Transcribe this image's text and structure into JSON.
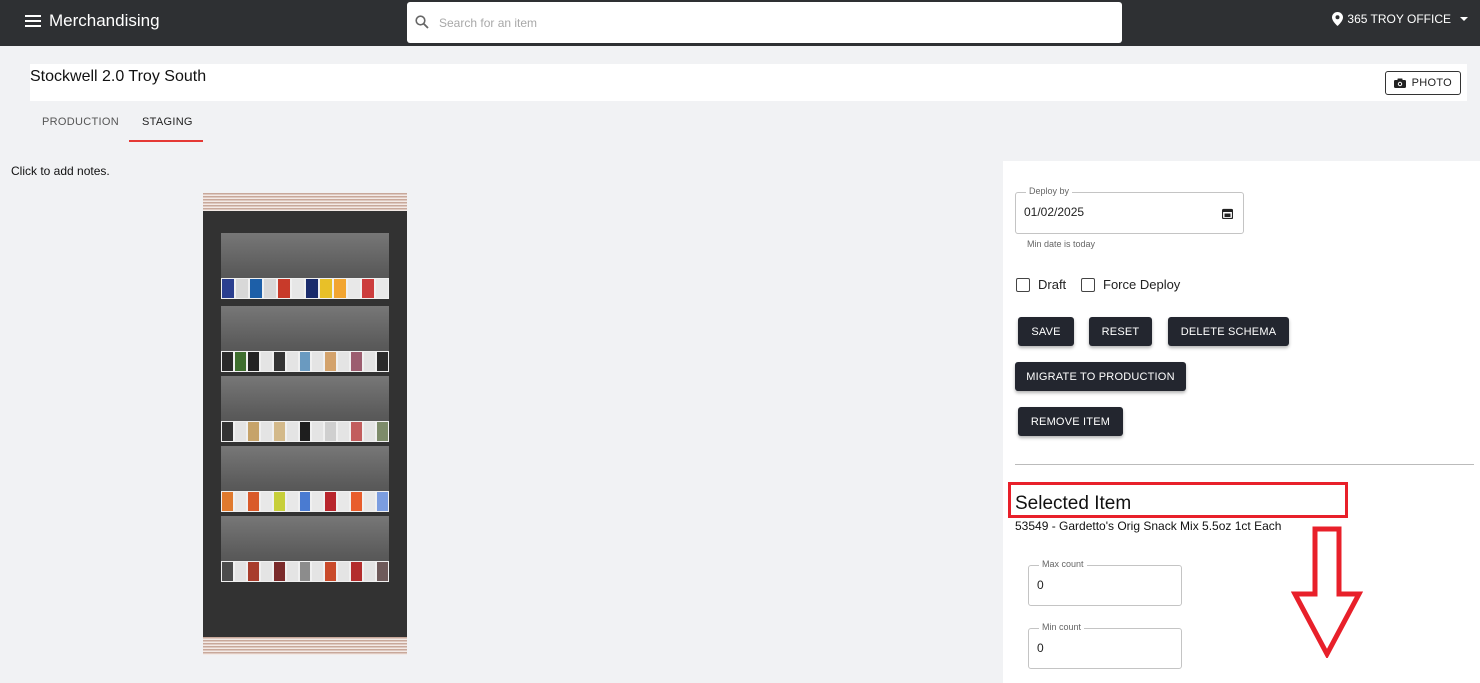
{
  "header": {
    "menu_icon": "hamburger-menu-icon",
    "app_title": "Merchandising",
    "search_placeholder": "Search for an item",
    "location": "365 TROY OFFICE"
  },
  "page": {
    "title": "Stockwell 2.0 Troy South",
    "photo_button": "PHOTO"
  },
  "tabs": [
    {
      "label": "PRODUCTION",
      "active": false
    },
    {
      "label": "STAGING",
      "active": true
    }
  ],
  "notes_placeholder": "Click to add notes.",
  "planogram": {
    "shelves": [
      {
        "colors": [
          "#2b3f8f",
          "#d8d8d8",
          "#1d5fa8",
          "#d8d8d8",
          "#c83a2a",
          "#e6e6e6",
          "#1a2b6b",
          "#e8c028",
          "#f2a531",
          "#e8e8e8",
          "#cc3d3d",
          "#e8e8e8"
        ]
      },
      {
        "colors": [
          "#2a2a2a",
          "#3e6e2e",
          "#222",
          "#e4e4e4",
          "#333",
          "#e4e4e4",
          "#6a9ac0",
          "#e4e4e4",
          "#d3a26b",
          "#e4e4e4",
          "#9c5d6f",
          "#e4e4e4",
          "#2a2a2a"
        ]
      },
      {
        "colors": [
          "#333",
          "#e4e4e4",
          "#c6a36a",
          "#e4e4e4",
          "#d3b98a",
          "#e4e4e4",
          "#1e1e1e",
          "#e4e4e4",
          "#cfcfcf",
          "#e4e4e4",
          "#c25d5d",
          "#e4e4e4",
          "#7d8b6a"
        ]
      },
      {
        "colors": [
          "#e07a2e",
          "#e8e8e8",
          "#d95a2a",
          "#e8e8e8",
          "#c7cf3a",
          "#e8e8e8",
          "#4a7bd1",
          "#e8e8e8",
          "#b8252c",
          "#e8e8e8",
          "#e85d2c",
          "#e8e8e8",
          "#7b9de0"
        ]
      },
      {
        "colors": [
          "#4c4c4c",
          "#e4e4e4",
          "#a83d2c",
          "#e4e4e4",
          "#7a2a2a",
          "#e4e4e4",
          "#8c8c8c",
          "#e4e4e4",
          "#c94a2a",
          "#e4e4e4",
          "#b32d2d",
          "#e4e4e4",
          "#6e5a5a"
        ]
      }
    ]
  },
  "deploy": {
    "label": "Deploy by",
    "date": "01/02/2025",
    "hint": "Min date is today"
  },
  "checkboxes": {
    "draft": {
      "label": "Draft",
      "checked": false
    },
    "force_deploy": {
      "label": "Force Deploy",
      "checked": false
    }
  },
  "buttons": {
    "save": "SAVE",
    "reset": "RESET",
    "delete_schema": "DELETE SCHEMA",
    "migrate": "MIGRATE TO PRODUCTION",
    "remove_item": "REMOVE ITEM"
  },
  "selected_item": {
    "heading": "Selected Item",
    "description": "53549 - Gardetto's Orig Snack Mix 5.5oz 1ct Each",
    "max_count_label": "Max count",
    "max_count": "0",
    "min_count_label": "Min count",
    "min_count": "0"
  },
  "annotation": {
    "highlight_color": "#e8202a",
    "arrow": "down-arrow-annotation"
  }
}
